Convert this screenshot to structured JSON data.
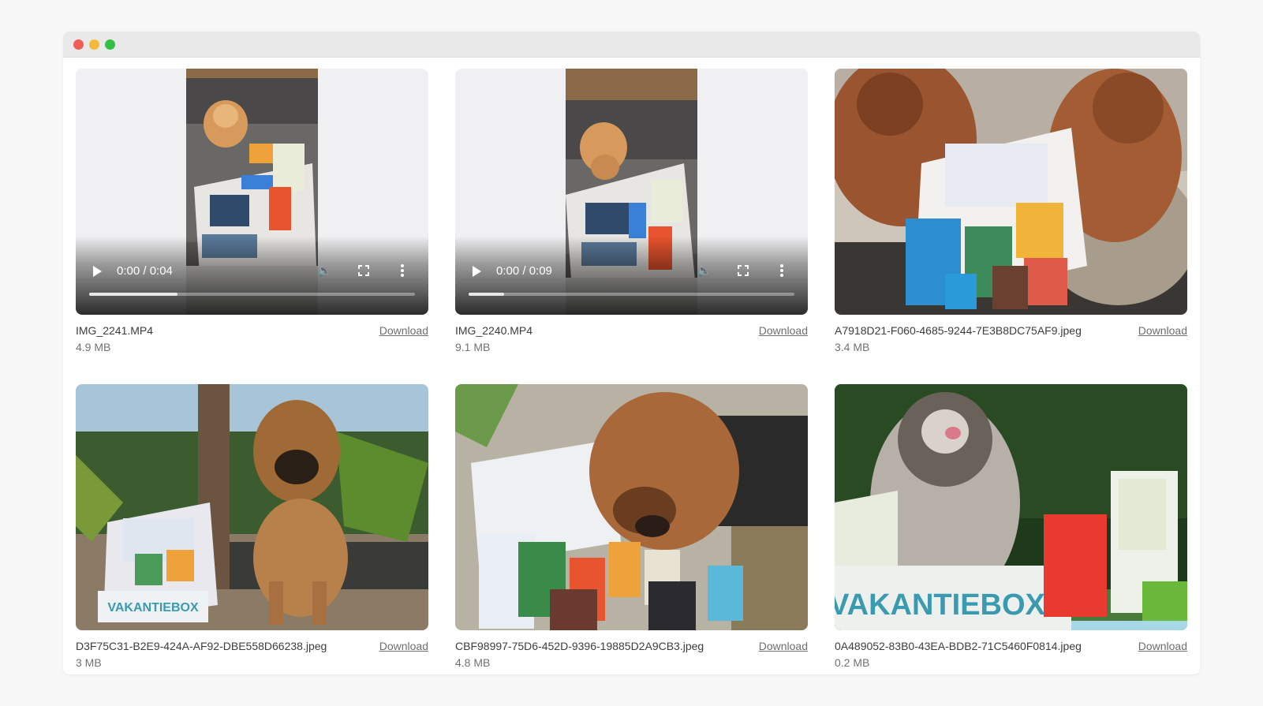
{
  "window": {
    "traffic_lights": [
      "close",
      "minimize",
      "zoom"
    ]
  },
  "files": [
    {
      "type": "video",
      "filename": "IMG_2241.MP4",
      "size": "4.9 MB",
      "download_label": "Download",
      "time": "0:00 / 0:04",
      "progress": 0.27
    },
    {
      "type": "video",
      "filename": "IMG_2240.MP4",
      "size": "9.1 MB",
      "download_label": "Download",
      "time": "0:00 / 0:09",
      "progress": 0.11
    },
    {
      "type": "image",
      "filename": "A7918D21-F060-4685-9244-7E3B8DC75AF9.jpeg",
      "size": "3.4 MB",
      "download_label": "Download"
    },
    {
      "type": "image",
      "filename": "D3F75C31-B2E9-424A-AF92-DBE558D66238.jpeg",
      "size": "3 MB",
      "download_label": "Download",
      "box_text": "VAKANTIEBOX"
    },
    {
      "type": "image",
      "filename": "CBF98997-75D6-452D-9396-19885D2A9CB3.jpeg",
      "size": "4.8 MB",
      "download_label": "Download"
    },
    {
      "type": "image",
      "filename": "0A489052-83B0-43EA-BDB2-71C5460F0814.jpeg",
      "size": "0.2 MB",
      "download_label": "Download",
      "box_text": "VAKANTIEBOX"
    }
  ],
  "colors": {
    "page_bg": "#f7f7f7",
    "titlebar": "#e9e9e9",
    "close": "#f05d56",
    "minimize": "#f5b93a",
    "zoom": "#32c048",
    "text": "#3d3d3d",
    "muted": "#727272"
  }
}
